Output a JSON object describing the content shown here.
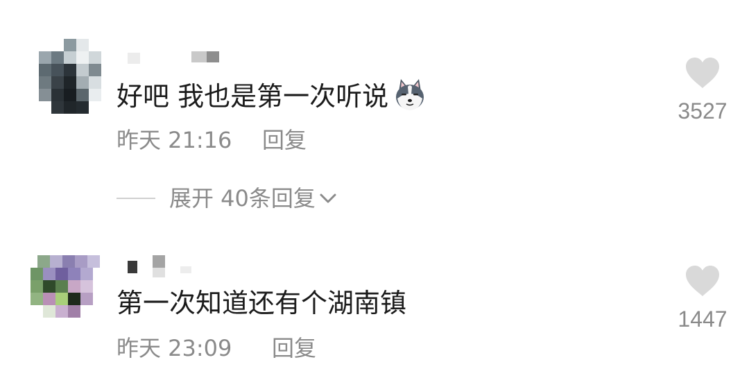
{
  "comments": [
    {
      "text": "好吧 我也是第一次听说",
      "emoji_icon": "husky-dog-emoji",
      "time": "昨天 21:16",
      "reply_label": "回复",
      "likes": "3527",
      "expand_label": "展开 40条回复"
    },
    {
      "text": "第一次知道还有个湖南镇",
      "time": "昨天 23:09",
      "reply_label": "回复",
      "likes": "1447"
    }
  ],
  "colors": {
    "text": "#1b1b1b",
    "secondary": "#8a8a8a",
    "heart": "#d9d9d9"
  }
}
